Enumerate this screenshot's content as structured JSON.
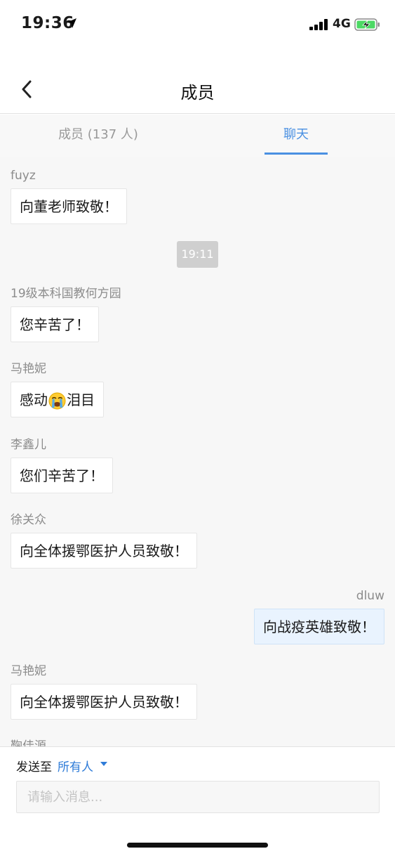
{
  "status_bar": {
    "time": "19:36",
    "network": "4G",
    "location_icon": "location-arrow-icon",
    "signal_icon": "cellular-signal-icon",
    "battery_icon": "battery-charging-icon"
  },
  "nav": {
    "title": "成员",
    "back_icon": "chevron-left-icon"
  },
  "tabs": [
    {
      "label": "成员 (137 人)",
      "active": false
    },
    {
      "label": "聊天",
      "active": true
    }
  ],
  "chat": {
    "messages": [
      {
        "sender": "fuyz",
        "text": "向董老师致敬！"
      },
      {
        "sender": "19级本科国教何方园",
        "text": "您辛苦了！"
      },
      {
        "sender": "马艳妮",
        "text_before": "感动",
        "emoji": "loudly-crying-face-icon",
        "text_after": "泪目"
      },
      {
        "sender": "李鑫儿",
        "text": "您们辛苦了！"
      },
      {
        "sender": "徐关众",
        "text": "向全体援鄂医护人员致敬！"
      },
      {
        "sender": "dluw",
        "text": "向战疫英雄致敬！",
        "self": true
      },
      {
        "sender": "马艳妮",
        "text": "向全体援鄂医护人员致敬！"
      },
      {
        "sender": "鞠佳源",
        "text": ""
      }
    ],
    "timestamp": "19:11"
  },
  "compose": {
    "send_to_label": "发送至",
    "send_target": "所有人",
    "dropdown_icon": "caret-down-icon",
    "input_placeholder": "请输入消息...",
    "input_value": ""
  },
  "colors": {
    "accent": "#4a90e2",
    "link": "#2f7cd8",
    "self_bubble": "#e9f3fe",
    "chat_bg": "#f7f7f7"
  }
}
